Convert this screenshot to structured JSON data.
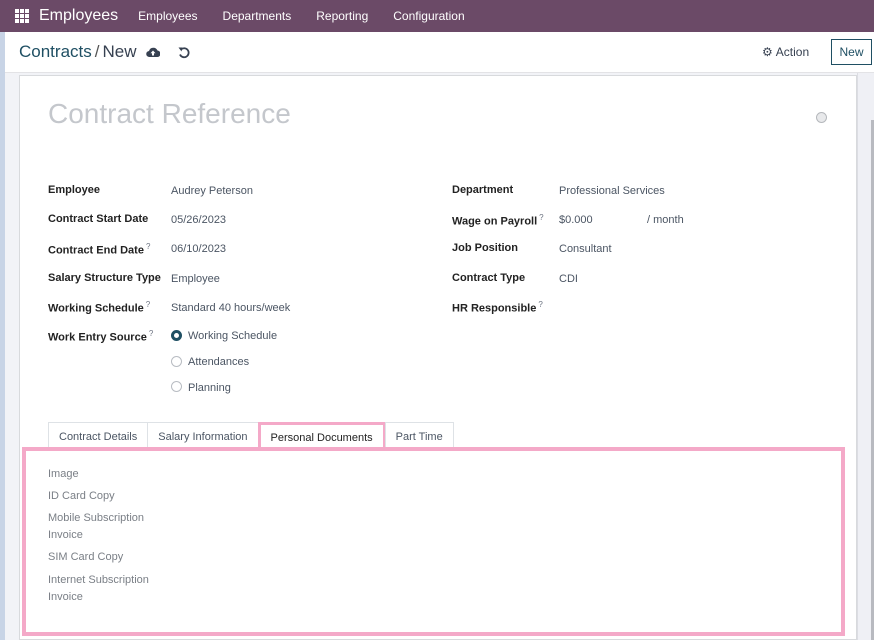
{
  "navbar": {
    "app_icon": "apps-grid-icon",
    "brand": "Employees",
    "menu": [
      "Employees",
      "Departments",
      "Reporting",
      "Configuration"
    ]
  },
  "control": {
    "breadcrumb_parent": "Contracts",
    "breadcrumb_separator": "/",
    "breadcrumb_current": "New",
    "save_icon": "cloud-upload-icon",
    "discard_icon": "undo-icon",
    "action_icon": "gear-icon",
    "action_label": "Action",
    "new_label": "New"
  },
  "form": {
    "reference_placeholder": "Contract Reference",
    "left_fields": [
      {
        "label": "Employee",
        "help": "",
        "value": "Audrey Peterson"
      },
      {
        "label": "Contract Start Date",
        "help": "",
        "value": "05/26/2023"
      },
      {
        "label": "Contract End Date",
        "help": "?",
        "value": "06/10/2023"
      },
      {
        "label": "Salary Structure Type",
        "help": "",
        "value": "Employee"
      },
      {
        "label": "Working Schedule",
        "help": "?",
        "value": "Standard 40 hours/week"
      }
    ],
    "work_entry_source": {
      "label": "Work Entry Source",
      "help": "?",
      "options": [
        "Working Schedule",
        "Attendances",
        "Planning"
      ],
      "selected": "Working Schedule"
    },
    "right_fields": [
      {
        "label": "Department",
        "help": "",
        "value": "Professional Services"
      },
      {
        "label": "Wage on Payroll",
        "help": "?",
        "value": "$0.000",
        "suffix": "/ month"
      },
      {
        "label": "Job Position",
        "help": "",
        "value": "Consultant"
      },
      {
        "label": "Contract Type",
        "help": "",
        "value": "CDI"
      },
      {
        "label": "HR Responsible",
        "help": "?",
        "value": ""
      }
    ]
  },
  "tabs": [
    {
      "label": "Contract Details",
      "active": false
    },
    {
      "label": "Salary Information",
      "active": false
    },
    {
      "label": "Personal Documents",
      "active": true
    },
    {
      "label": "Part Time",
      "active": false
    }
  ],
  "personal_documents": {
    "items": [
      "Image",
      "ID Card Copy",
      "Mobile Subscription",
      "Invoice",
      "SIM Card Copy",
      "Internet Subscription",
      "Invoice"
    ]
  },
  "colors": {
    "navbar": "#6b4a67",
    "accent": "#1f4f63",
    "highlight": "#f4a9c8"
  }
}
